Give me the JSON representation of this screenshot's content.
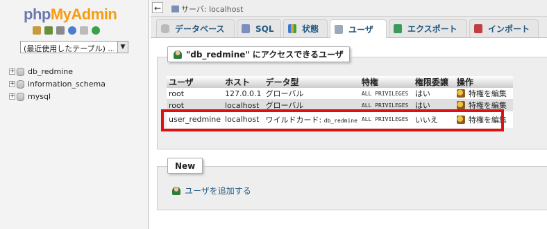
{
  "nav": {
    "logo_php": "php",
    "logo_my": "My",
    "logo_admin": "Admin",
    "recent_select": "(最近使用したテーブル) ...",
    "databases": [
      "db_redmine",
      "information_schema",
      "mysql"
    ]
  },
  "topbar": {
    "back": "←",
    "server_label": "サーバ: localhost"
  },
  "tabs": [
    "データベース",
    "SQL",
    "状態",
    "ユーザ",
    "エクスポート",
    "インポート"
  ],
  "users_section": {
    "legend": "\"db_redmine\" にアクセスできるユーザ",
    "headers": [
      "ユーザ",
      "ホスト",
      "データ型",
      "特権",
      "権限委譲",
      "操作"
    ],
    "rows": [
      {
        "user": "root",
        "host": "127.0.0.1",
        "type": "グローバル",
        "priv": "ALL PRIVILEGES",
        "grant": "はい",
        "action": "特権を編集"
      },
      {
        "user": "root",
        "host": "localhost",
        "type": "グローバル",
        "priv": "ALL PRIVILEGES",
        "grant": "はい",
        "action": "特権を編集"
      },
      {
        "user": "user_redmine",
        "host": "localhost",
        "type": "ワイルドカード:",
        "type_db": "db_redmine",
        "priv": "ALL PRIVILEGES",
        "grant": "いいえ",
        "action": "特権を編集"
      }
    ]
  },
  "new_section": {
    "legend": "New",
    "add_user": "ユーザを追加する"
  },
  "colors": {
    "link": "#235a81",
    "highlight": "#e01010"
  }
}
